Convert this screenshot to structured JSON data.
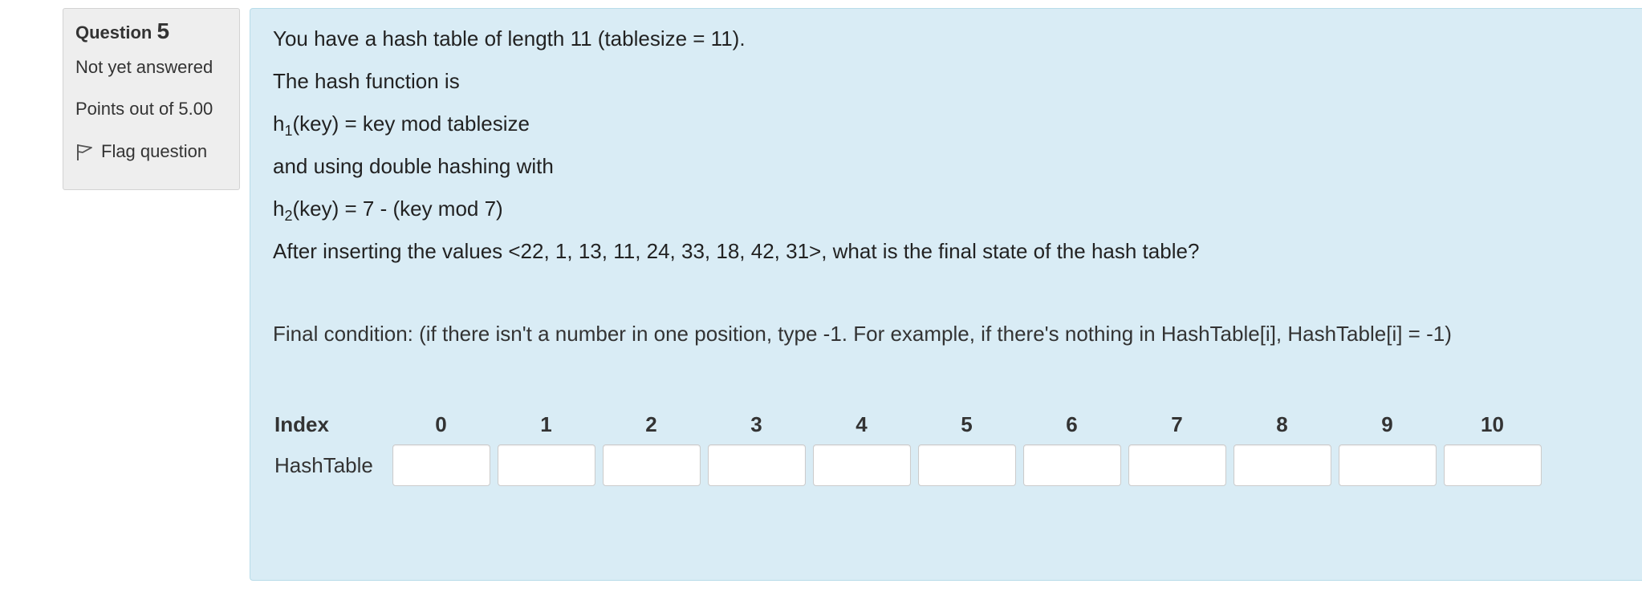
{
  "info": {
    "question_label": "Question",
    "question_number": "5",
    "state": "Not yet answered",
    "grade": "Points out of 5.00",
    "flag_label": "Flag question"
  },
  "question": {
    "line1": "You have a hash table of length 11 (tablesize = 11).",
    "line2": "The hash function is",
    "h1_prefix": "h",
    "h1_sub": "1",
    "h1_rest": "(key) = key mod tablesize",
    "line4": "and using double hashing with",
    "h2_prefix": "h",
    "h2_sub": "2",
    "h2_rest": "(key) = 7 - (key mod 7)",
    "line6": "After inserting the values <22, 1, 13, 11, 24, 33, 18, 42, 31>, what is the final state of the hash table?",
    "prompt": "Final condition: (if there isn't a number in one position, type -1. For example, if there's nothing in HashTable[i], HashTable[i] = -1)"
  },
  "table": {
    "index_label": "Index",
    "row_label": "HashTable",
    "indices": [
      "0",
      "1",
      "2",
      "3",
      "4",
      "5",
      "6",
      "7",
      "8",
      "9",
      "10"
    ],
    "values": [
      "",
      "",
      "",
      "",
      "",
      "",
      "",
      "",
      "",
      "",
      ""
    ]
  },
  "colors": {
    "content_bg": "#d9ecf5",
    "info_bg": "#eeeeee"
  }
}
